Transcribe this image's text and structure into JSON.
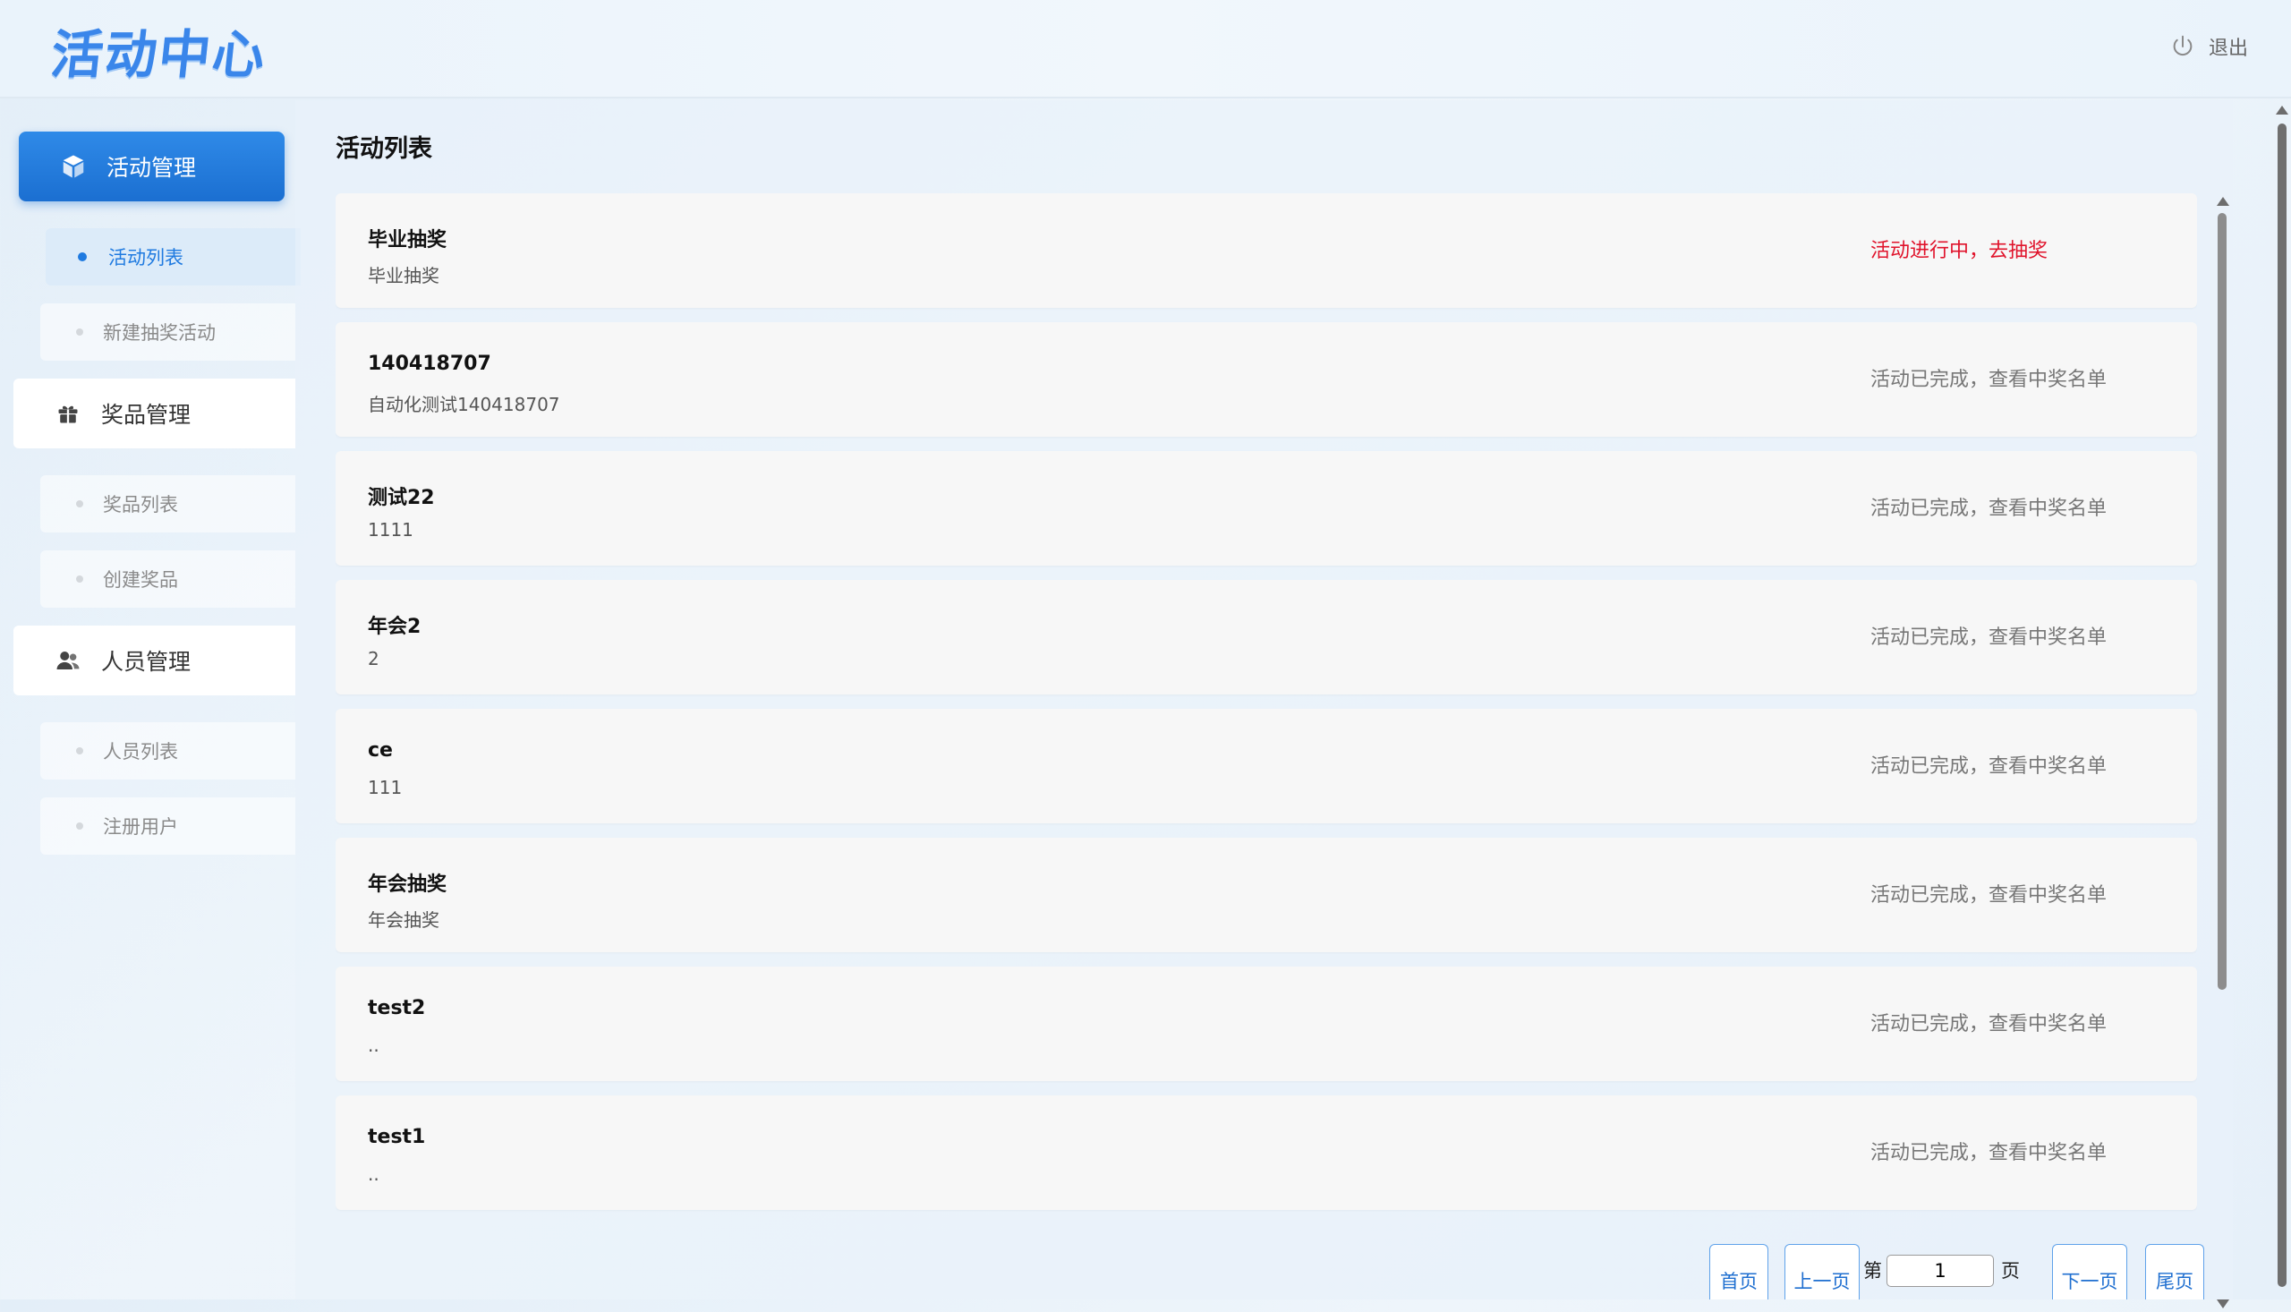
{
  "header": {
    "logo": "活动中心",
    "logout_label": "退出"
  },
  "sidebar": {
    "groups": [
      {
        "label": "活动管理",
        "icon": "cube-icon",
        "active": true,
        "items": [
          {
            "label": "活动列表",
            "current": true
          },
          {
            "label": "新建抽奖活动",
            "current": false
          }
        ]
      },
      {
        "label": "奖品管理",
        "icon": "gift-icon",
        "active": false,
        "items": [
          {
            "label": "奖品列表",
            "current": false
          },
          {
            "label": "创建奖品",
            "current": false
          }
        ]
      },
      {
        "label": "人员管理",
        "icon": "users-icon",
        "active": false,
        "items": [
          {
            "label": "人员列表",
            "current": false
          },
          {
            "label": "注册用户",
            "current": false
          }
        ]
      }
    ]
  },
  "main": {
    "title": "活动列表",
    "activities": [
      {
        "name": "毕业抽奖",
        "desc": "毕业抽奖",
        "status": "活动进行中，去抽奖",
        "live": true
      },
      {
        "name": "140418707",
        "desc": "自动化测试140418707",
        "status": "活动已完成，查看中奖名单",
        "live": false
      },
      {
        "name": "测试22",
        "desc": "1111",
        "status": "活动已完成，查看中奖名单",
        "live": false
      },
      {
        "name": "年会2",
        "desc": "2",
        "status": "活动已完成，查看中奖名单",
        "live": false
      },
      {
        "name": "ce",
        "desc": "111",
        "status": "活动已完成，查看中奖名单",
        "live": false
      },
      {
        "name": "年会抽奖",
        "desc": "年会抽奖",
        "status": "活动已完成，查看中奖名单",
        "live": false
      },
      {
        "name": "test2",
        "desc": "..",
        "status": "活动已完成，查看中奖名单",
        "live": false
      },
      {
        "name": "test1",
        "desc": "..",
        "status": "活动已完成，查看中奖名单",
        "live": false
      }
    ]
  },
  "pager": {
    "first": "首页",
    "prev": "上一页",
    "page_prefix": "第",
    "page_value": "1",
    "page_suffix": "页",
    "next": "下一页",
    "last": "尾页"
  },
  "colors": {
    "accent": "#1f7ae0",
    "live_status": "#e0132b"
  }
}
